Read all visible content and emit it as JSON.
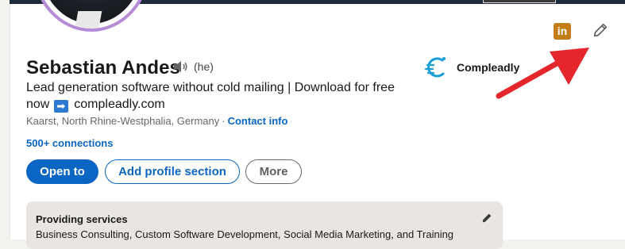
{
  "profile": {
    "name": "Sebastian Andes",
    "pronoun": "(he)",
    "headline_part1": "Lead generation software without cold mailing | Download for free now",
    "headline_part2": "compleadly.com",
    "location": "Kaarst, North Rhine-Westphalia, Germany",
    "contact_info_label": "Contact info",
    "connections": "500+ connections",
    "company": "Compleadly"
  },
  "actions": {
    "open_to": "Open to",
    "add_section": "Add profile section",
    "more": "More"
  },
  "services": {
    "title": "Providing services",
    "list": "Business Consulting, Custom Software Development, Social Media Marketing, and Training"
  },
  "icons": {
    "linkedin_badge": "in",
    "arrow_emoji": "➡",
    "edit": "pencil-icon",
    "speaker": "speaker-icon"
  },
  "colors": {
    "brand_blue": "#0a66c2",
    "linkedin_badge": "#c37d16",
    "annotation_red": "#e5262a",
    "avatar_ring": "#b58ad6"
  }
}
